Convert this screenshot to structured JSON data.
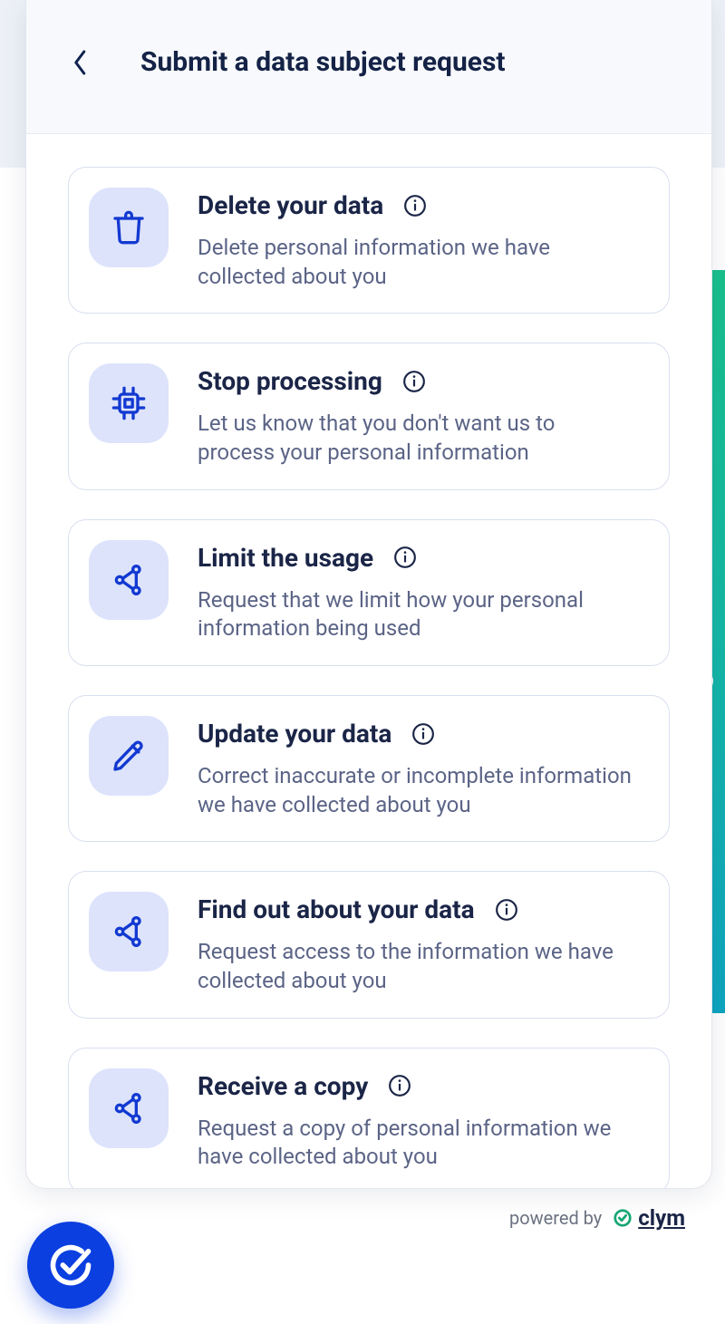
{
  "header": {
    "title": "Submit a data subject request"
  },
  "options": [
    {
      "icon": "trash-icon",
      "title": "Delete your data",
      "description": "Delete personal information we have collected about you"
    },
    {
      "icon": "chip-icon",
      "title": "Stop processing",
      "description": "Let us know that you don't want us to process your personal information"
    },
    {
      "icon": "share-icon",
      "title": "Limit the usage",
      "description": "Request that we limit how your personal information being used"
    },
    {
      "icon": "pencil-icon",
      "title": "Update your data",
      "description": "Correct inaccurate or incomplete information we have collected about you"
    },
    {
      "icon": "share-icon",
      "title": "Find out about your data",
      "description": "Request access to the information we have collected about you"
    },
    {
      "icon": "share-icon",
      "title": "Receive a copy",
      "description": "Request a copy of personal information we have collected about you"
    }
  ],
  "footer": {
    "powered_by": "powered by",
    "brand": "clym"
  }
}
